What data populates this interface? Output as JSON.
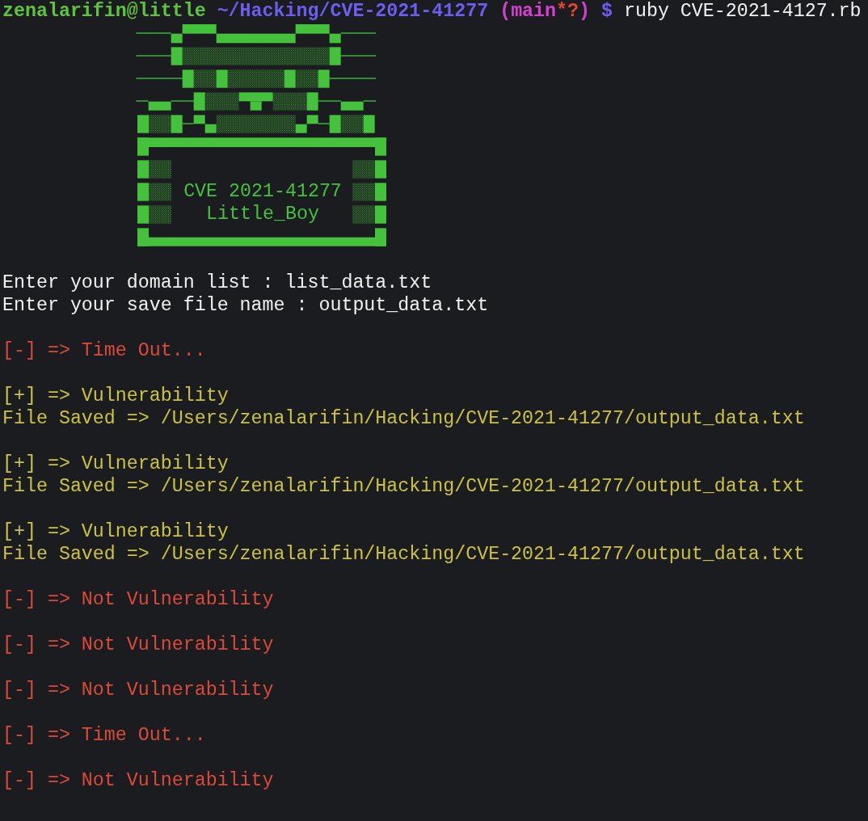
{
  "prompt": {
    "user_host": "zenalarifin@little",
    "path": "~/Hacking/CVE-2021-41277",
    "branch": "(main",
    "git_status": "*?",
    "branch_end": ")",
    "symbol": "$",
    "command": "ruby CVE-2021-4127.rb"
  },
  "banner": {
    "title": "CVE 2021-41277",
    "subtitle": "Little_Boy"
  },
  "output": [
    {
      "lines": [
        {
          "kind": "input",
          "text": "Enter your domain list : list_data.txt"
        },
        {
          "kind": "input",
          "text": "Enter your save file name : output_data.txt"
        }
      ]
    },
    {
      "lines": [
        {
          "kind": "error",
          "text": "[-] => Time Out..."
        }
      ]
    },
    {
      "lines": [
        {
          "kind": "success",
          "text": "[+] => Vulnerability"
        },
        {
          "kind": "success",
          "text": "File Saved => /Users/zenalarifin/Hacking/CVE-2021-41277/output_data.txt"
        }
      ]
    },
    {
      "lines": [
        {
          "kind": "success",
          "text": "[+] => Vulnerability"
        },
        {
          "kind": "success",
          "text": "File Saved => /Users/zenalarifin/Hacking/CVE-2021-41277/output_data.txt"
        }
      ]
    },
    {
      "lines": [
        {
          "kind": "success",
          "text": "[+] => Vulnerability"
        },
        {
          "kind": "success",
          "text": "File Saved => /Users/zenalarifin/Hacking/CVE-2021-41277/output_data.txt"
        }
      ]
    },
    {
      "lines": [
        {
          "kind": "error",
          "text": "[-] => Not Vulnerability"
        }
      ]
    },
    {
      "lines": [
        {
          "kind": "error",
          "text": "[-] => Not Vulnerability"
        }
      ]
    },
    {
      "lines": [
        {
          "kind": "error",
          "text": "[-] => Not Vulnerability"
        }
      ]
    },
    {
      "lines": [
        {
          "kind": "error",
          "text": "[-] => Time Out..."
        }
      ]
    },
    {
      "lines": [
        {
          "kind": "error",
          "text": "[-] => Not Vulnerability"
        }
      ]
    }
  ]
}
